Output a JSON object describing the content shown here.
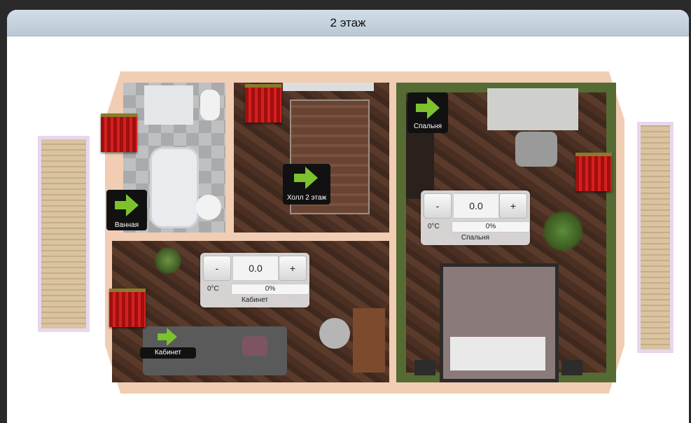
{
  "title": "2 этаж",
  "rooms": {
    "bath": {
      "label": "Ванная"
    },
    "hall": {
      "label": "Холл 2 этаж"
    },
    "bedroom": {
      "label": "Спальня"
    },
    "office": {
      "label": "Кабинет"
    }
  },
  "controls": {
    "bedroom": {
      "minus": "-",
      "value": "0.0",
      "plus": "+",
      "temp": "0°C",
      "percent": "0%",
      "name": "Спальня"
    },
    "office": {
      "minus": "-",
      "value": "0.0",
      "plus": "+",
      "temp": "0°C",
      "percent": "0%",
      "name": "Кабинет"
    }
  },
  "colors": {
    "arrow": "#7dc22e",
    "curtain": "#c91a1a",
    "titlebar": "#c6d3df"
  },
  "icons": {
    "nav": "arrow-right-icon",
    "curtain": "curtain-icon"
  }
}
